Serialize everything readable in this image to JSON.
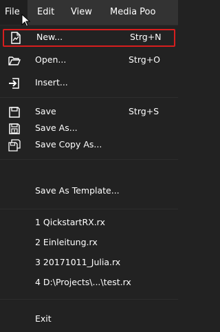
{
  "menubar": {
    "items": [
      "File",
      "Edit",
      "View",
      "Media Poo"
    ]
  },
  "menu": {
    "new": {
      "label": "New...",
      "shortcut": "Strg+N",
      "icon": "new-document-icon"
    },
    "open": {
      "label": "Open...",
      "shortcut": "Strg+O",
      "icon": "folder-open-icon"
    },
    "insert": {
      "label": "Insert...",
      "icon": "insert-icon"
    },
    "save": {
      "label": "Save",
      "shortcut": "Strg+S",
      "icon": "save-icon"
    },
    "save_as": {
      "label": "Save As...",
      "icon": "save-as-icon"
    },
    "save_copy_as": {
      "label": "Save Copy As...",
      "icon": "save-copy-icon"
    },
    "save_as_template": {
      "label": "Save As Template..."
    },
    "recent": [
      "1 QickstartRX.rx",
      "2 Einleitung.rx",
      "3 20171011_Julia.rx",
      "4 D:\\Projects\\...\\test.rx"
    ],
    "exit": {
      "label": "Exit"
    }
  },
  "colors": {
    "background": "#222222",
    "menubar": "#333333",
    "highlight_border": "#d81e1e"
  }
}
